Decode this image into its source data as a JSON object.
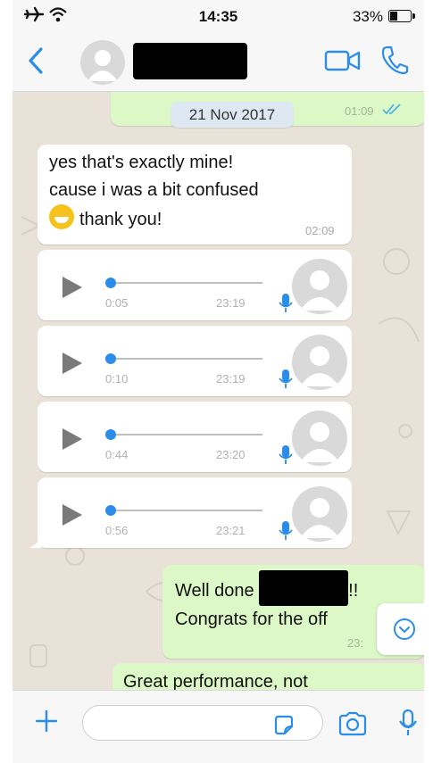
{
  "status_bar": {
    "time": "14:35",
    "battery": "33%"
  },
  "header": {
    "back_label": "<"
  },
  "date_chip": "21 Nov 2017",
  "out_top": {
    "time": "01:09"
  },
  "message_in": {
    "line1": "yes that's exactly mine!",
    "line2": "cause i was a bit confused",
    "line3": "thank you!",
    "time": "02:09"
  },
  "voice_messages": [
    {
      "duration": "0:05",
      "time": "23:19"
    },
    {
      "duration": "0:10",
      "time": "23:19"
    },
    {
      "duration": "0:44",
      "time": "23:20"
    },
    {
      "duration": "0:56",
      "time": "23:21"
    }
  ],
  "message_out": {
    "line1_prefix": "Well done",
    "line1_suffix": "!!",
    "line2": "Congrats for the off",
    "time": "23:"
  },
  "message_out2": {
    "line1": "Great performance, not"
  },
  "colors": {
    "accent": "#2c8de8",
    "outgoing": "#dcf8c6",
    "incoming": "#ffffff",
    "date_chip": "#dde8f2"
  }
}
